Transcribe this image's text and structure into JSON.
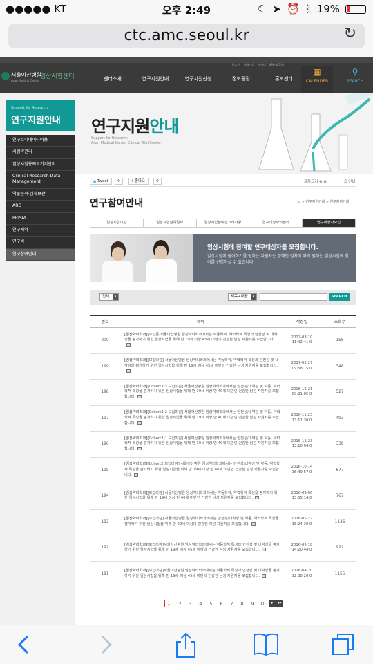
{
  "status": {
    "carrier": "●●●●● KT",
    "time": "오후 2:49",
    "battery": "19%",
    "battery_color": "#e4312b"
  },
  "browser": {
    "url": "ctc.amc.seoul.kr"
  },
  "header": {
    "toplinks": [
      "로그인",
      "회원가입",
      "아이디 / 비밀번호찾기"
    ],
    "logo_name": "서울아산병원",
    "logo_center": "임상시험센터",
    "logo_en": "Asan Medical Center",
    "menu": [
      "센터소개",
      "연구지원안내",
      "연구지원신청",
      "정보광장",
      "홍보센터"
    ],
    "calendar": "CALENDER",
    "search": "SEARCH"
  },
  "sidebar": {
    "sub": "Support for Research",
    "title": "연구지원안내",
    "items": [
      "연구코디네이터이용",
      "시험약관리",
      "임상시험용의료기기관리",
      "Clinical Research Data Management",
      "약물분석·검체보관",
      "ARO",
      "PRISM",
      "연구계약",
      "연구비",
      "연구참여안내"
    ]
  },
  "visual": {
    "title_a": "연구지원",
    "title_b": "안내",
    "sub1": "Support for Research",
    "sub2": "Asan Medical Center Clinical Trial Center"
  },
  "social": {
    "tweet": "Tweet",
    "tweet_count": "0",
    "like": "좋아요",
    "like_count": "0",
    "zoom": "글자크기",
    "print": "인쇄"
  },
  "page": {
    "title": "연구참여안내",
    "breadcrumb": "> 연구지원안내 > 연구참여안내"
  },
  "tabs": [
    "임상시험이란",
    "임상시험참여절차",
    "임상시험참여전고려사항",
    "연구대상자의권리",
    "연구대상자모집"
  ],
  "banner": {
    "title": "임상시험에 참여할 연구대상자를 모집합니다.",
    "text": "임상시험에 참여하기를 원하는 자원자는 정해진 절차에 따라 원하는 임상시험에 참여를 신청하실 수 있습니다."
  },
  "search": {
    "filter1": "전체",
    "filter2": "제목+내용",
    "button": "SEARCH"
  },
  "table": {
    "headers": [
      "번호",
      "제목",
      "작성일",
      "조회수"
    ],
    "rows": [
      {
        "no": "200",
        "cat": "[임상약리학과]",
        "title": "[모집중]서울아산병원 임상약리학과에서는 약동학적, 약력학적 특성과 안전성 및 내약성을 평가하기 위한 임상시험을 위해 만 19세 이상 45세 미만의 건강한 남성 자원자를 모집합니다.",
        "date": "2017-03-10",
        "time": "11:42:41.0",
        "views": "158"
      },
      {
        "no": "199",
        "cat": "[임상약리학과]",
        "title": "[모집마감] 서울아산병원 임상약리학과에서는 약동학적, 약력학적 특성과 안전성 및 내약성을 평가하기 위한 임상시험을 위해 만 19세 이상 45세 미만의 건강한 남성 자원자를 모집합니다.",
        "date": "2017-02-27",
        "time": "09:58:15.0",
        "views": "348"
      },
      {
        "no": "198",
        "cat": "[임상약리학과]",
        "title": "[Cohort3-3 모집마감] 서울아산병원 임상약리학과에서는 안전성/내약성 및 약동, 약력학적 특성을 평가하기 위한 임상시험을 위해 만 19세 이상 만 40세 미만인 건강한 남성 자원자를 모집합니다.",
        "date": "2016-12-21",
        "time": "09:21:05.0",
        "views": "527"
      },
      {
        "no": "197",
        "cat": "[임상약리학과]",
        "title": "[Cohort3-2 모집마감] 서울아산병원 임상약리학과에서는 안전성/내약성 및 약동, 약력학적 특성을 평가하기 위한 임상시험을 위해 만 19세 이상 만 40세 미만인 건강한 남성 자원자를 모집합니다.",
        "date": "2016-11-23",
        "time": "13:11:30.0",
        "views": "493"
      },
      {
        "no": "196",
        "cat": "[임상약리학과]",
        "title": "[Cohort3-1 모집마감] 서울아산병원 임상약리학과에서는 안전성/내약성 및 약동, 약력학적 특성을 평가하기 위한 임상시험을 위해 만 19세 이상 만 40세 미만인 건강한 남성 자원자를 모집합니다.",
        "date": "2016-11-23",
        "time": "13:10:04.0",
        "views": "338"
      },
      {
        "no": "195",
        "cat": "[임상약리학과]",
        "title": "[Cohort2 모집마감] 서울아산병원 임상약리학과에서는 안전성/내약성 및 약동, 약력학적 특성을 평가하기 위한 임상시험을 위해 만 19세 이상 만 40세 미만인 건강한 남성 자원자를 모집합니다.",
        "date": "2016-10-14",
        "time": "16:49:57.0",
        "views": "677"
      },
      {
        "no": "194",
        "cat": "[임상약리학과]",
        "title": "[모집마감] 서울아산병원 임상약리학과에서는 약동학적, 약력학적 특성을 평가하기 위한 임상시험을 위해 만 19세 이상 만 40세 미만인 건강한 남성 자원자를 모집합니다.",
        "date": "2016-09-06",
        "time": "13:55:14.0",
        "views": "767"
      },
      {
        "no": "193",
        "cat": "[임상약리학과]",
        "title": "[모집마감] 서울아산병원 임상약리학과에서는 안전성/내약성 및 약동, 약력학적 특성을 평가하기 위한 임상시험을 위해 만 20세 이상의 건강한 여성 자원자를 모집합니다.",
        "date": "2016-05-27",
        "time": "15:24:30.0",
        "views": "1136"
      },
      {
        "no": "192",
        "cat": "[임상약리학과]",
        "title": "[모집마감]서울아산병원 임상약리학과에서는 약동학적 특성과 안전성 및 내약성을 평가하기 위한 임상시험을 위해 만 19세 이상 45세 이하의 건강한 남성 자원자를 모집합니다.",
        "date": "2016-05-18",
        "time": "14:20:44.0",
        "views": "922"
      },
      {
        "no": "191",
        "cat": "[임상약리학과]",
        "title": "[모집마감]서울아산병원 임상약리학과에서는 약동학적 특성과 안전성 및 내약성을 평가하기 위한 임상시험을 위해 만 19세 이상 45세 미만의 건강한 남성 자원자를 모집합니다.",
        "date": "2016-04-20",
        "time": "12:38:20.0",
        "views": "1155"
      }
    ]
  },
  "pager": {
    "pages": [
      "1",
      "2",
      "3",
      "4",
      "5",
      "6",
      "7",
      "8",
      "9",
      "10"
    ],
    "current": "1",
    "next": "▸",
    "last": "▸▸"
  },
  "toolbar": {
    "back": "back-icon",
    "forward": "forward-icon",
    "share": "share-icon",
    "bookmarks": "bookmarks-icon",
    "tabs": "tabs-icon"
  }
}
